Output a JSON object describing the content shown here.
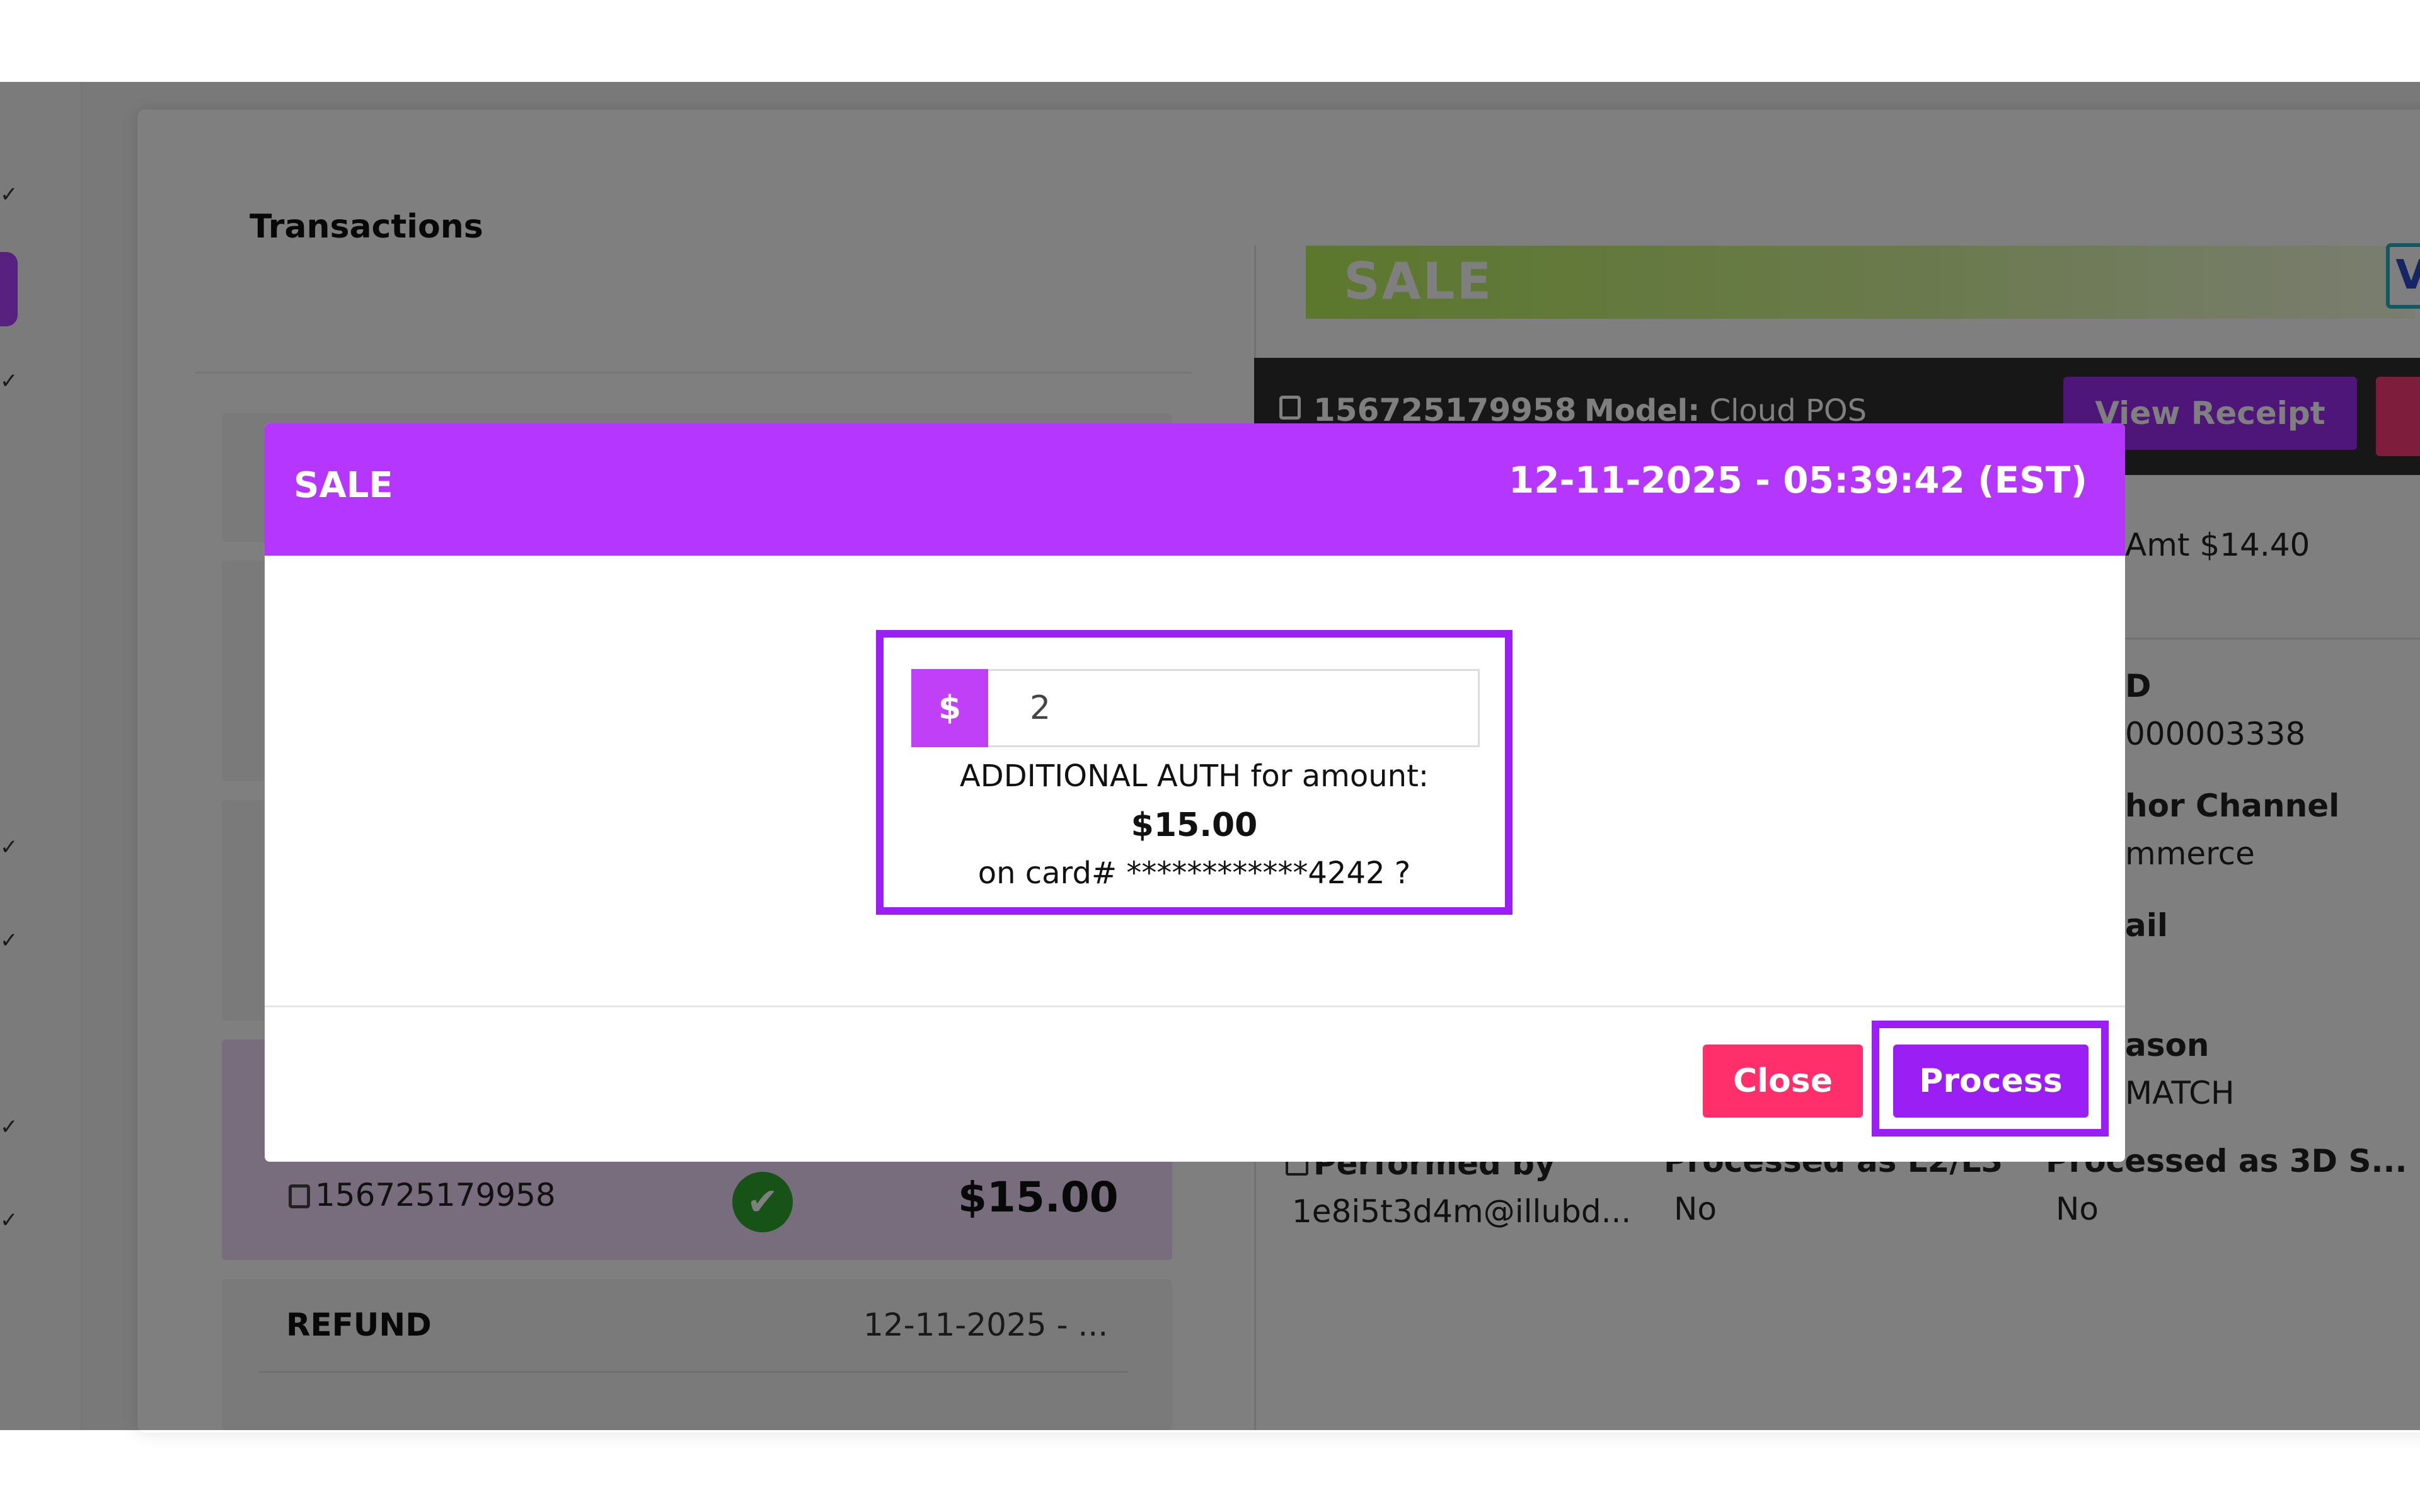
{
  "transactions_panel": {
    "title": "Transactions",
    "selected_item": {
      "terminal_id": "156725179958",
      "amount": "$15.00"
    },
    "next_item": {
      "type": "REFUND",
      "date": "12-11-2025 - ..."
    }
  },
  "detail_panel": {
    "banner": "SALE",
    "brand_letter": "V",
    "terminal_id": "156725179958",
    "model_label": "Model:",
    "model_value": "Cloud POS",
    "view_receipt_label": "View Receipt",
    "partial_amt": "Amt $14.40",
    "partial_id_label": "D",
    "partial_id_value": "000003338",
    "partial_channel_label": "hor Channel",
    "partial_channel_value": "mmerce",
    "partial_email_label": "ail",
    "partial_reason_label": "ason",
    "partial_reason_value": "MATCH",
    "performed_by_label": "Performed by",
    "performed_by_value": "1e8i5t3d4m@illubd...",
    "processed_l2l3_label": "Processed as L2/L3",
    "processed_l2l3_value": "No",
    "processed_3ds_label": "Processed as 3D S...",
    "processed_3ds_value": "No"
  },
  "modal": {
    "title": "SALE",
    "datetime": "12-11-2025 - 05:39:42 (EST)",
    "currency_symbol": "$",
    "amount_value": "2",
    "prompt_line": "ADDITIONAL AUTH for amount:",
    "auth_amount": "$15.00",
    "card_line": "on card# ************4242 ?",
    "close_label": "Close",
    "process_label": "Process"
  },
  "colors": {
    "modal_header": "#b436ff",
    "primary": "#9b1ff5",
    "close_button": "#ff2f6b",
    "success": "#2ea52e"
  }
}
